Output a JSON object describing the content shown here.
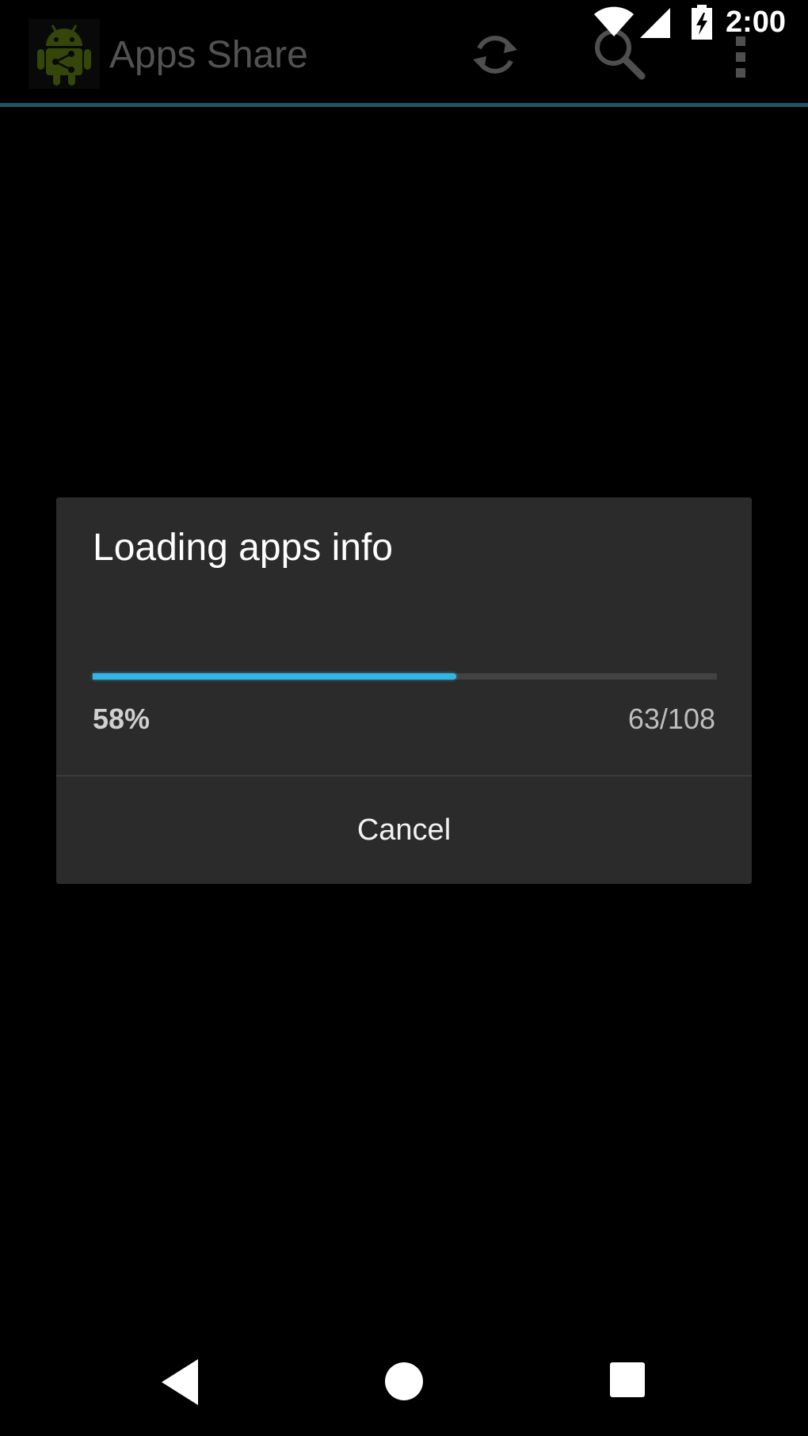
{
  "status_bar": {
    "time": "2:00",
    "icons": [
      "wifi-icon",
      "signal-icon",
      "battery-charging-icon"
    ]
  },
  "action_bar": {
    "title": "Apps Share",
    "app_icon": "android-share-icon",
    "actions": [
      {
        "name": "refresh",
        "icon": "refresh-icon"
      },
      {
        "name": "search",
        "icon": "search-icon"
      },
      {
        "name": "overflow",
        "icon": "overflow-menu-icon"
      }
    ],
    "divider_color": "#1f5566"
  },
  "dialog": {
    "title": "Loading apps info",
    "progress": {
      "fraction": 0.583,
      "percent_label": "58%",
      "count_label": "63/108"
    },
    "cancel_label": "Cancel",
    "accent_color": "#33b5e5"
  },
  "nav_bar": {
    "buttons": [
      "back-icon",
      "home-icon",
      "recents-icon"
    ]
  }
}
